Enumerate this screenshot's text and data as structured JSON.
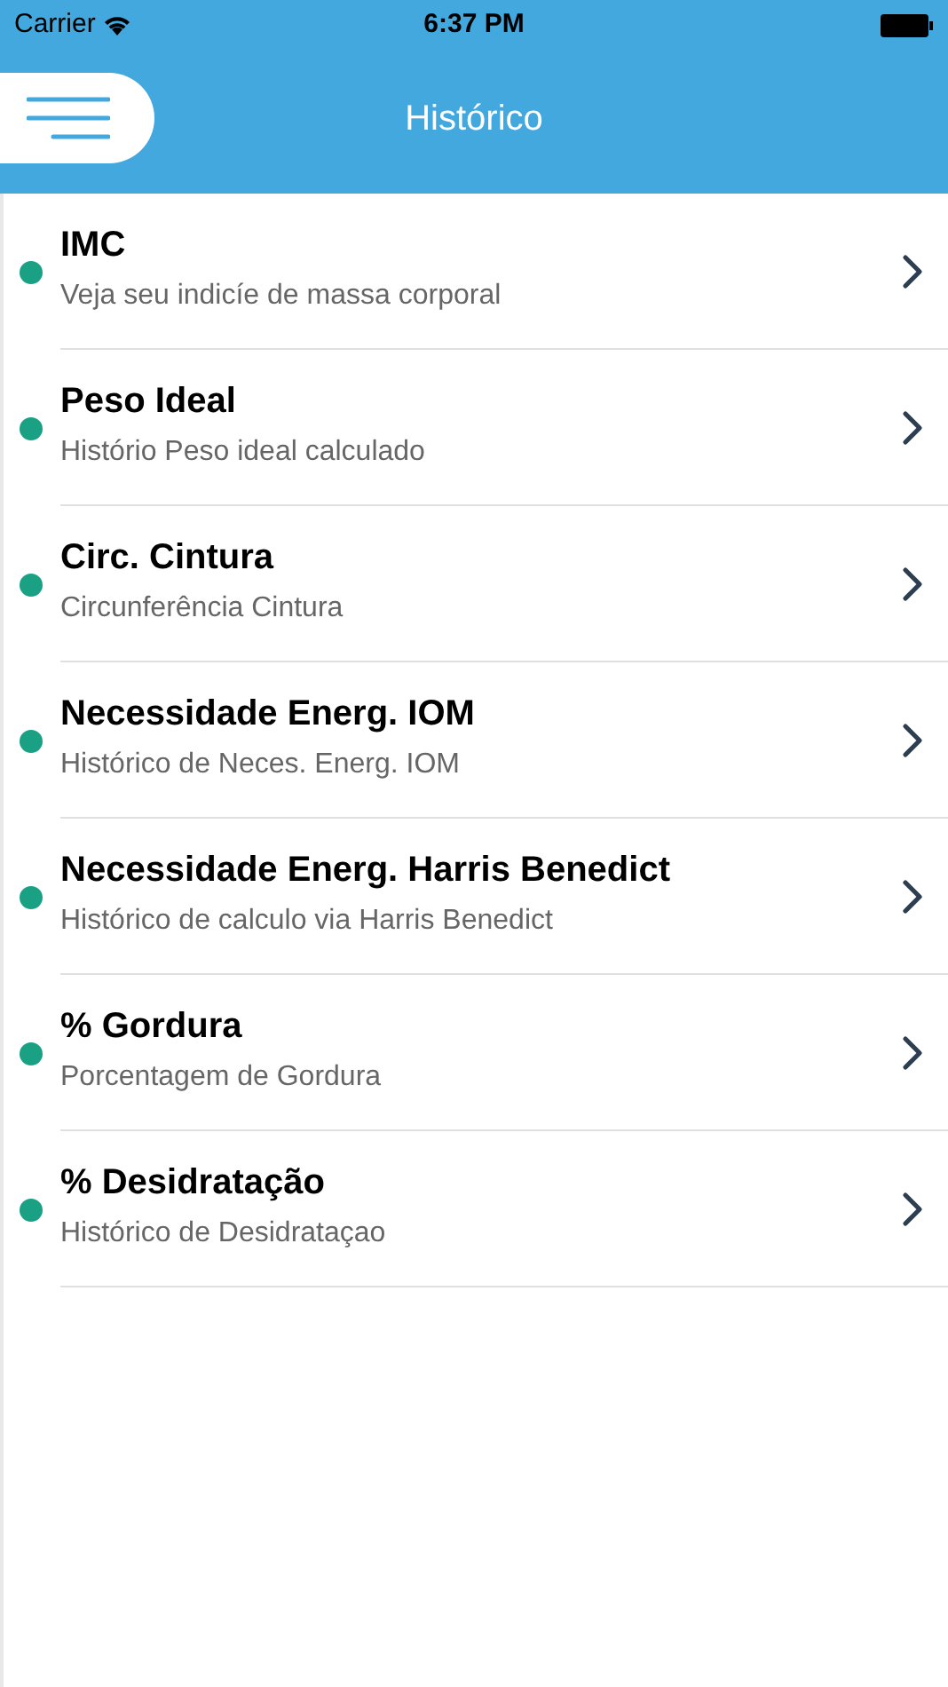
{
  "status_bar": {
    "carrier": "Carrier",
    "time": "6:37 PM"
  },
  "nav_bar": {
    "title": "Histórico"
  },
  "items": [
    {
      "title": "IMC",
      "subtitle": "Veja seu indicíe de massa corporal"
    },
    {
      "title": "Peso Ideal",
      "subtitle": "Histório Peso ideal calculado"
    },
    {
      "title": "Circ. Cintura",
      "subtitle": "Circunferência Cintura"
    },
    {
      "title": "Necessidade Energ. IOM",
      "subtitle": "Histórico de Neces. Energ. IOM"
    },
    {
      "title": "Necessidade Energ. Harris Benedict",
      "subtitle": "Histórico de calculo via Harris Benedict"
    },
    {
      "title": "% Gordura",
      "subtitle": "Porcentagem de Gordura"
    },
    {
      "title": "% Desidratação",
      "subtitle": "Histórico de Desidrataçao"
    }
  ]
}
